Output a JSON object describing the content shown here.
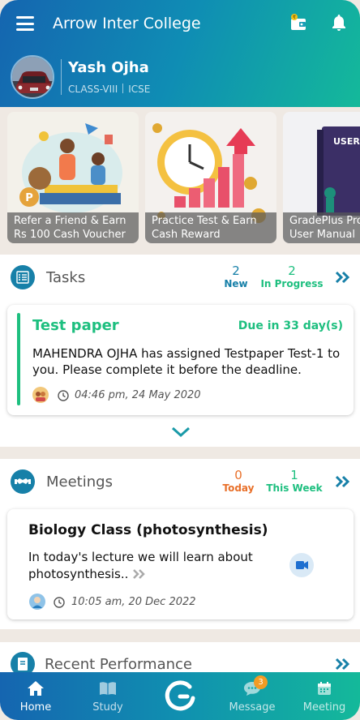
{
  "app": {
    "title": "Arrow Inter College"
  },
  "user": {
    "name": "Yash Ojha",
    "class": "CLASS-VIII",
    "board": "ICSE"
  },
  "banners": [
    {
      "line1": "Refer a Friend & Earn",
      "line2": "Rs 100 Cash Voucher"
    },
    {
      "line1": "Practice Test & Earn",
      "line2": "Cash Reward"
    },
    {
      "line1": "GradePlus Pro",
      "line2": "User Manual",
      "image_text": "USER MANU"
    }
  ],
  "tasks": {
    "title": "Tasks",
    "stats": [
      {
        "count": "2",
        "label": "New"
      },
      {
        "count": "2",
        "label": "In Progress"
      }
    ],
    "item": {
      "title": "Test paper",
      "due": "Due in 33 day(s)",
      "description": "MAHENDRA OJHA has assigned Testpaper Test-1 to you. Please complete it before the deadline.",
      "timestamp": "04:46 pm, 24 May 2020"
    }
  },
  "meetings": {
    "title": "Meetings",
    "stats": [
      {
        "count": "0",
        "label": "Today"
      },
      {
        "count": "1",
        "label": "This Week"
      }
    ],
    "item": {
      "title": "Biology Class (photosynthesis)",
      "description_line1": "In today's lecture we will learn about",
      "description_line2": "photosynthesis..",
      "timestamp": "10:05 am, 20 Dec 2022"
    }
  },
  "performance": {
    "title": "Recent Performance"
  },
  "nav": {
    "home": "Home",
    "study": "Study",
    "message": "Message",
    "message_badge": "3",
    "meeting": "Meeting"
  },
  "colors": {
    "header_start": "#1565b0",
    "header_end": "#14b99a",
    "green": "#1dbf7f",
    "blue": "#1780a8",
    "orange": "#e8702a"
  }
}
